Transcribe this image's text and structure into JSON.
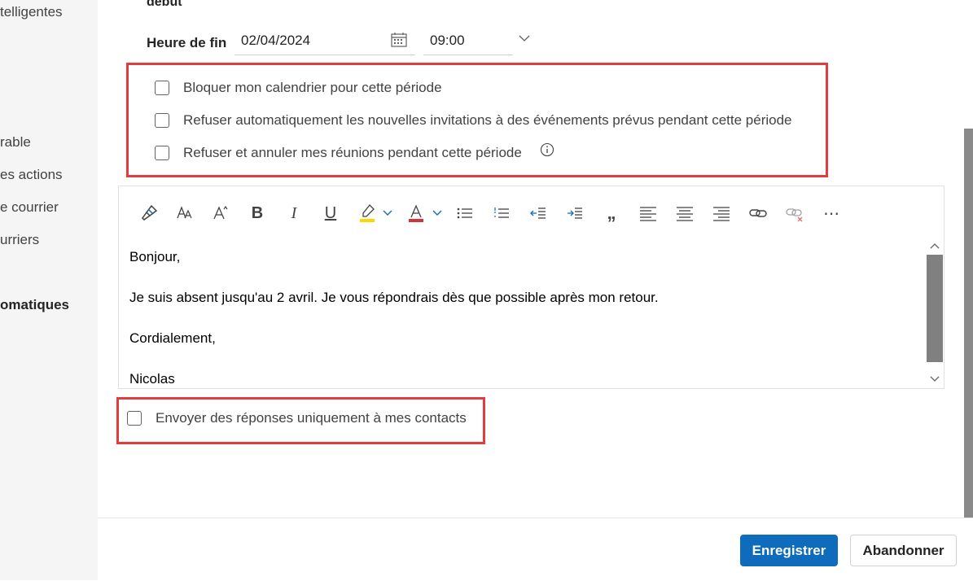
{
  "sidebar": {
    "items": [
      {
        "label": "telligentes"
      },
      {
        "label": "rable"
      },
      {
        "label": "es actions"
      },
      {
        "label": "e courrier"
      },
      {
        "label": "urriers"
      },
      {
        "label": "omatiques"
      }
    ]
  },
  "form": {
    "start_label": "début",
    "end_label": "Heure de fin",
    "end_date": "02/04/2024",
    "end_time": "09:00"
  },
  "options": {
    "block_calendar": {
      "label": "Bloquer mon calendrier pour cette période",
      "checked": false
    },
    "decline_new": {
      "label": "Refuser automatiquement les nouvelles invitations à des événements prévus pendant cette période",
      "checked": false
    },
    "decline_cancel": {
      "label": "Refuser et annuler mes réunions pendant cette période",
      "checked": false
    }
  },
  "editor": {
    "lines": [
      "Bonjour,",
      "Je suis absent jusqu'au 2 avril. Je vous répondrais dès que possible après mon retour.",
      "Cordialement,",
      "Nicolas"
    ],
    "toolbar": [
      "format-painter",
      "font-size",
      "change-case",
      "bold",
      "italic",
      "underline",
      "highlight",
      "font-color",
      "bullets",
      "numbering",
      "decrease-indent",
      "increase-indent",
      "quote",
      "align-left",
      "align-center",
      "align-right",
      "link",
      "remove-link",
      "more"
    ],
    "bold_glyph": "B",
    "italic_glyph": "I",
    "underline_glyph": "U",
    "quote_glyph": "„",
    "more_glyph": "⋯",
    "highlight_color": "#ffd700",
    "font_color": "#d13438"
  },
  "contacts_only": {
    "label": "Envoyer des réponses uniquement à mes contacts",
    "checked": false
  },
  "footer": {
    "save_label": "Enregistrer",
    "cancel_label": "Abandonner"
  },
  "colors": {
    "accent": "#0f6cbd",
    "highlight_box": "#e23d3d"
  }
}
